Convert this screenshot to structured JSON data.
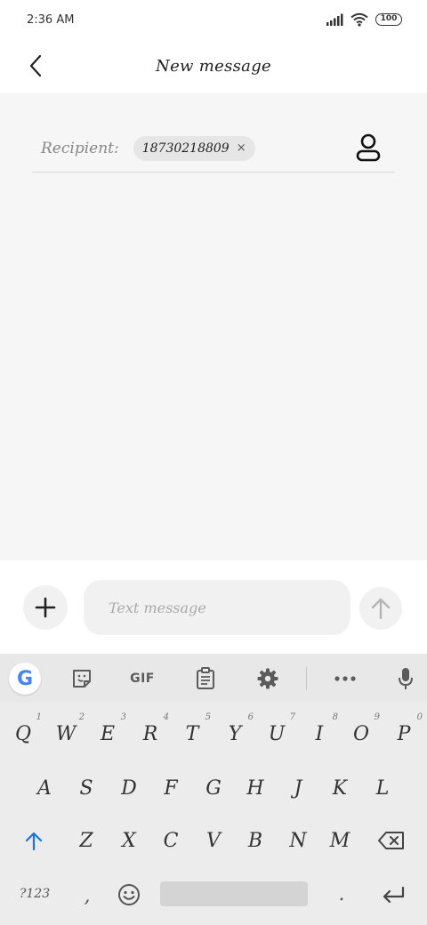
{
  "status_bar": {
    "time": "2:36 AM",
    "battery": "100",
    "icons": [
      "signal-icon",
      "wifi-icon",
      "battery-icon"
    ]
  },
  "header": {
    "title": "New message",
    "back_icon": "chevron-left-icon"
  },
  "recipient": {
    "label": "Recipient:",
    "chip_value": "18730218809",
    "chip_close": "×",
    "contact_icon": "contact-person-icon"
  },
  "compose": {
    "attach_icon": "plus-icon",
    "placeholder": "Text message",
    "send_icon": "arrow-up-icon"
  },
  "keyboard": {
    "toolbar": {
      "google": "G",
      "gif": "GIF",
      "icons": [
        "google-icon",
        "sticker-icon",
        "gif-icon",
        "clipboard-icon",
        "gear-icon",
        "more-icon",
        "mic-icon"
      ]
    },
    "row1": [
      "Q",
      "W",
      "E",
      "R",
      "T",
      "Y",
      "U",
      "I",
      "O",
      "P"
    ],
    "row1_hints": [
      "1",
      "2",
      "3",
      "4",
      "5",
      "6",
      "7",
      "8",
      "9",
      "0"
    ],
    "row2": [
      "A",
      "S",
      "D",
      "F",
      "G",
      "H",
      "J",
      "K",
      "L"
    ],
    "row3": [
      "Z",
      "X",
      "C",
      "V",
      "B",
      "N",
      "M"
    ],
    "symbols_key": "?123",
    "comma_key": ",",
    "period_key": ".",
    "colors": {
      "shift_blue": "#1a73e8",
      "google_blue": "#4285F4",
      "google_red": "#EA4335",
      "google_yellow": "#FBBC05",
      "google_green": "#34A853"
    }
  }
}
